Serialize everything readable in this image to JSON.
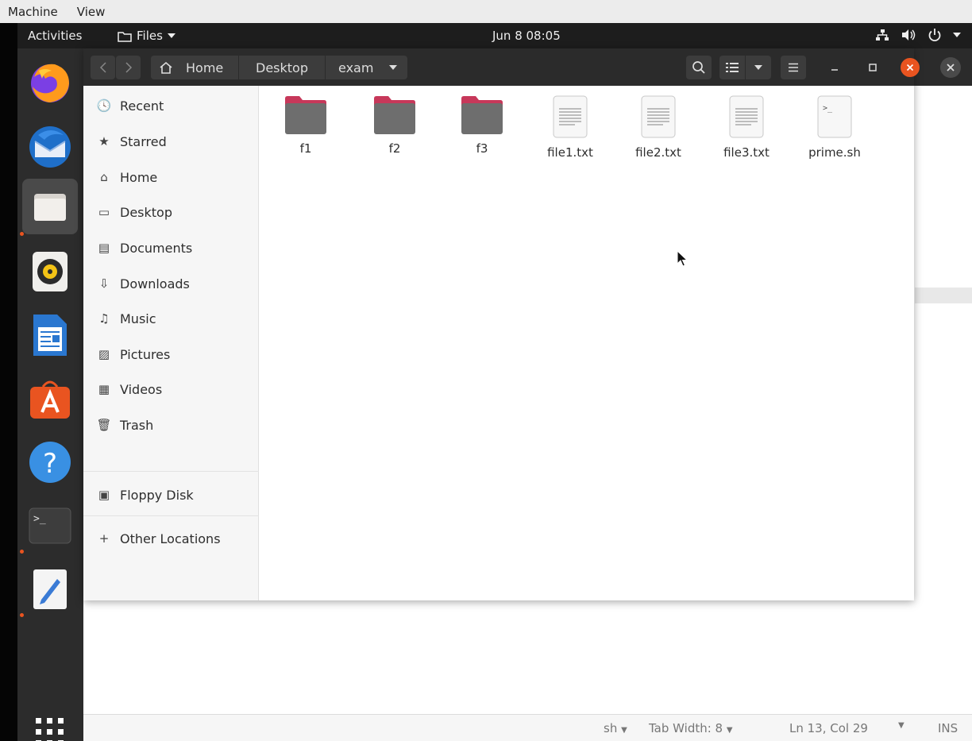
{
  "vm_menu": [
    "Machine",
    "View"
  ],
  "topbar": {
    "activities": "Activities",
    "app_menu": "Files",
    "clock": "Jun 8  08:05"
  },
  "dock": {
    "apps": [
      "firefox-icon",
      "thunderbird-icon",
      "files-icon",
      "rhythmbox-icon",
      "libreoffice-writer-icon",
      "software-center-icon",
      "help-icon",
      "terminal-icon",
      "text-editor-icon"
    ],
    "show_apps": "apps-grid-icon"
  },
  "files_window": {
    "breadcrumbs": [
      "Home",
      "Desktop",
      "exam"
    ],
    "sidebar": {
      "places": [
        "Recent",
        "Starred",
        "Home",
        "Desktop",
        "Documents",
        "Downloads",
        "Music",
        "Pictures",
        "Videos",
        "Trash"
      ],
      "devices": [
        "Floppy Disk"
      ],
      "other": "Other Locations"
    },
    "items": [
      {
        "name": "f1",
        "type": "folder"
      },
      {
        "name": "f2",
        "type": "folder"
      },
      {
        "name": "f3",
        "type": "folder"
      },
      {
        "name": "file1.txt",
        "type": "text"
      },
      {
        "name": "file2.txt",
        "type": "text"
      },
      {
        "name": "file3.txt",
        "type": "text"
      },
      {
        "name": "prime.sh",
        "type": "script"
      }
    ]
  },
  "gedit_status": {
    "language": "sh",
    "tab_width": "Tab Width: 8",
    "position": "Ln 13, Col 29",
    "mode": "INS"
  },
  "colors": {
    "accent": "#e95420",
    "folder_body": "#6e6e6e",
    "folder_tab": "#c7385a"
  }
}
